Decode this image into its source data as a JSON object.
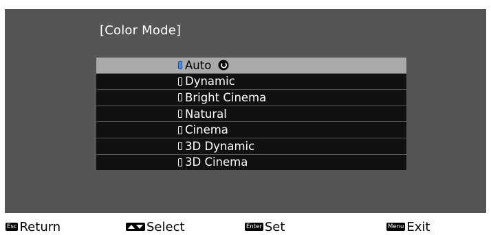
{
  "title": "[Color Mode]",
  "modes": [
    {
      "label": "Auto",
      "selected": true
    },
    {
      "label": "Dynamic",
      "selected": false
    },
    {
      "label": "Bright Cinema",
      "selected": false
    },
    {
      "label": "Natural",
      "selected": false
    },
    {
      "label": "Cinema",
      "selected": false
    },
    {
      "label": "3D Dynamic",
      "selected": false
    },
    {
      "label": "3D Cinema",
      "selected": false
    }
  ],
  "footer": {
    "return": {
      "key": "Esc",
      "label": "Return"
    },
    "select": {
      "label": "Select"
    },
    "set": {
      "key": "Enter",
      "label": "Set"
    },
    "exit": {
      "key": "Menu",
      "label": "Exit"
    }
  },
  "colors": {
    "panel": "#555555",
    "row": "#111111",
    "selected_row": "#a9a9a9",
    "indicator_selected": "#4f8fe6"
  }
}
